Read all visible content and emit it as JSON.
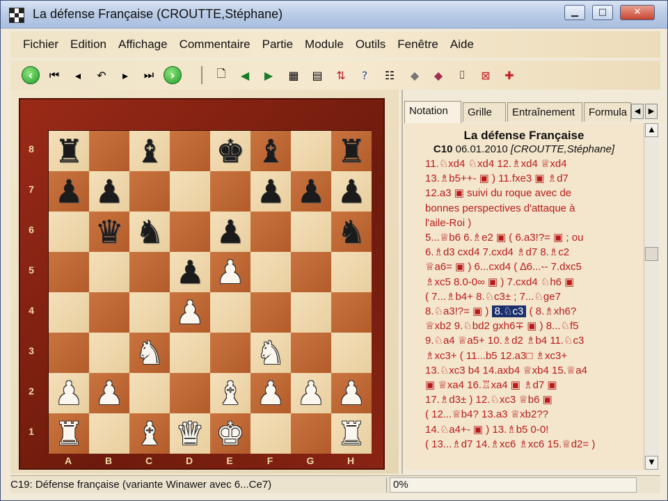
{
  "window": {
    "title": "La défense Française  (CROUTTE,Stéphane)"
  },
  "menu": [
    "Fichier",
    "Edition",
    "Affichage",
    "Commentaire",
    "Partie",
    "Module",
    "Outils",
    "Fenêtre",
    "Aide"
  ],
  "toolbar": {
    "icons": [
      "back-green-icon",
      "first-move-icon",
      "prev-move-icon",
      "takeback-icon",
      "next-move-icon",
      "last-move-icon",
      "forward-green-icon",
      "new-document-icon",
      "arrow-left-icon",
      "arrow-right-icon",
      "save-icon",
      "save-all-icon",
      "sort-icon",
      "help-icon",
      "properties-icon",
      "eraser-icon",
      "eraser2-icon",
      "camera-icon",
      "delete-icon",
      "crosshair-icon"
    ]
  },
  "board": {
    "files": [
      "A",
      "B",
      "C",
      "D",
      "E",
      "F",
      "G",
      "H"
    ],
    "ranks": [
      "8",
      "7",
      "6",
      "5",
      "4",
      "3",
      "2",
      "1"
    ],
    "position": [
      [
        "bR",
        "",
        "bB",
        "",
        "bK",
        "bB",
        "",
        "bR"
      ],
      [
        "bP",
        "bP",
        "",
        "",
        "",
        "bP",
        "bP",
        "bP"
      ],
      [
        "",
        "bQ",
        "bN",
        "",
        "bP",
        "",
        "",
        "bN"
      ],
      [
        "",
        "",
        "",
        "bP",
        "wP",
        "",
        "",
        ""
      ],
      [
        "",
        "",
        "",
        "wP",
        "",
        "",
        "",
        ""
      ],
      [
        "",
        "",
        "wN",
        "",
        "",
        "wN",
        "",
        ""
      ],
      [
        "wP",
        "wP",
        "",
        "",
        "wB",
        "wP",
        "wP",
        "wP"
      ],
      [
        "wR",
        "",
        "wB",
        "wQ",
        "wK",
        "",
        "",
        "wR"
      ]
    ]
  },
  "tabs": [
    "Notation",
    "Grille",
    "Entraînement",
    "Formula"
  ],
  "game": {
    "title": "La défense Française",
    "eco": "C10",
    "date": "06.01.2010",
    "player": "[CROUTTE,Stéphane]",
    "lines": [
      "11.♘xd4   ♘xd4   12.♗xd4   ♕xd4",
      "13.♗b5++-  ▣ )  11.fxe3   ▣   ♗d7",
      "12.a3    ▣   suivi du roque avec de",
      "bonnes perspectives d'attaque à",
      "l'aile-Roi )",
      "5...♕b6  6.♗e2  ▣  ( 6.a3!?=  ▣ ; ou",
      "6.♗d3  cxd4  7.cxd4   ♗d7  8.♗c2",
      "♕a6=  ▣ )  6...cxd4  ( ∆6...-- 7.dxc5",
      "♗xc5  8.0-0∞  ▣ )  7.cxd4  ♘h6  ▣",
      "( 7...♗b4+      8.♘c3± ;      7...♘ge7",
      "8.♘a3!?=    ▣ )   8.♘c3   ( 8.♗xh6?",
      "♕xb2  9.♘bd2  gxh6∓ ▣ )  8...♘f5",
      "9.♘a4   ♕a5+  10.♗d2  ♗b4  11.♘c3",
      "♗xc3+     ( 11...b5   12.a3□   ♗xc3+",
      "13.♘xc3  b4  14.axb4  ♕xb4  15.♕a4",
      "▣    ♕xa4  16.♖xa4   ▣   ♗d7  ▣",
      "17.♗d3± )     12.♘xc3      ♕b6    ▣",
      "( 12...♕b4?      13.a3      ♕xb2??",
      "14.♘a4+-   ▣ )   13.♗b5    0-0!",
      "( 13...♗d7  14.♗xc6  ♗xc6  15.♕d2= )"
    ],
    "highlighted_move": "8.♘c3"
  },
  "status": {
    "text": "C19: Défense française (variante Winawer avec 6...Ce7)",
    "progress": "0%"
  },
  "colors": {
    "dark_square": "#b35c2b",
    "light_square": "#f4dfb9",
    "frame": "#8a2414",
    "annotation": "#b81b1b",
    "highlight": "#1a2f6c"
  }
}
